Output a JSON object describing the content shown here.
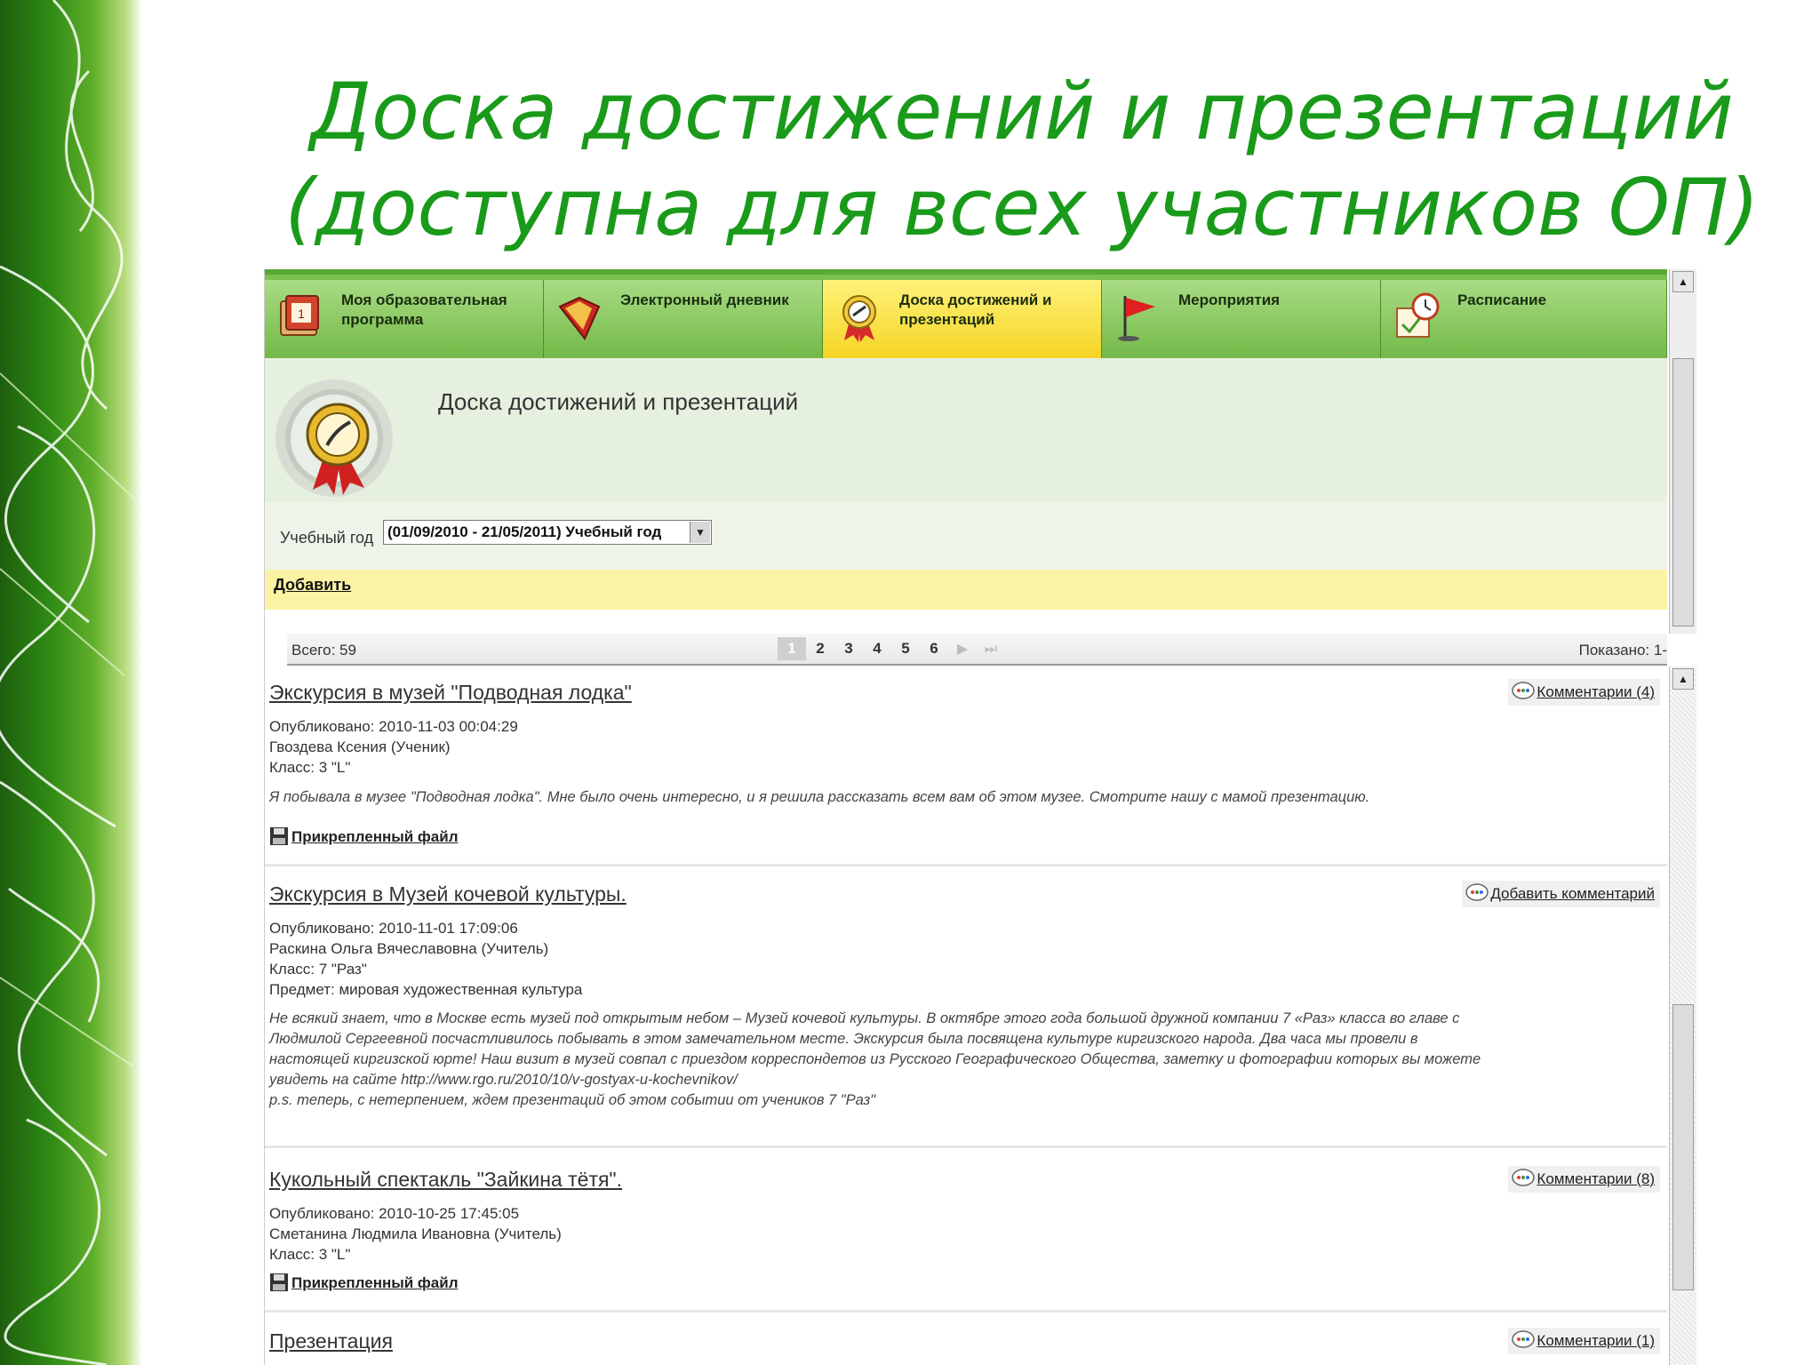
{
  "slide": {
    "title_line1": "Доска достижений и презентаций",
    "title_line2": "(доступна для всех участников ОП)"
  },
  "colors": {
    "title_green": "#1a9a1a",
    "tab_green": "#7cc050",
    "tab_active": "#f4d21e",
    "add_bar": "#fbf2a3"
  },
  "tabs": [
    {
      "label": "Моя образовательная программа",
      "icon": "calendar-book-icon",
      "active": false
    },
    {
      "label": "Электронный дневник",
      "icon": "diary-book-icon",
      "active": false
    },
    {
      "label": "Доска достижений и презентаций",
      "icon": "medal-icon",
      "active": true
    },
    {
      "label": "Мероприятия",
      "icon": "flag-icon",
      "active": false
    },
    {
      "label": "Расписание",
      "icon": "clock-calendar-icon",
      "active": false
    }
  ],
  "page": {
    "heading": "Доска достижений и презентаций"
  },
  "filter": {
    "year_label": "Учебный год",
    "year_value": "(01/09/2010 - 21/05/2011) Учебный год"
  },
  "add_label": "Добавить",
  "pager": {
    "total": "Всего: 59",
    "pages": [
      "1",
      "2",
      "3",
      "4",
      "5",
      "6"
    ],
    "current_page": "1",
    "shown": "Показано: 1-"
  },
  "posts": [
    {
      "title": "Экскурсия в музей \"Подводная лодка\"",
      "published": "Опубликовано: 2010-11-03 00:04:29",
      "author": "Гвоздева Ксения (Ученик)",
      "class": "Класс: 3 \"L\"",
      "description": "Я побывала в музее \"Подводная лодка\". Мне было очень интересно, и я решила рассказать всем вам об этом музее. Смотрите нашу с мамой презентацию.",
      "attachment": "Прикрепленный файл",
      "comments": "Комментарии (4)"
    },
    {
      "title": "Экскурсия в Музей кочевой культуры.",
      "published": "Опубликовано: 2010-11-01 17:09:06",
      "author": "Раскина Ольга Вячеславовна (Учитель)",
      "class": "Класс: 7 \"Раз\"",
      "subject": "Предмет: мировая художественная культура",
      "description_lines": [
        "Не всякий знает, что в Москве есть музей под открытым небом – Музей кочевой культуры. В октябре этого года большой дружной компании 7 «Раз» класса во главе с",
        "Людмилой Сергеевной посчастливилось побывать в этом замечательном месте. Экскурсия была посвящена культуре киргизского народа. Два часа мы провели в",
        "настоящей киргизской юрте! Наш визит в музей совпал с приездом корреспондетов из Русского Географического Общества, заметку и фотографии которых вы можете",
        "увидеть на сайте http://www.rgo.ru/2010/10/v-gostyax-u-kochevnikov/",
        "p.s. теперь, с нетерпением, ждем презентаций об этом событии от учеников 7 \"Раз\""
      ],
      "comments": "Добавить комментарий"
    },
    {
      "title": "Кукольный спектакль \"Зайкина тётя\".",
      "published": "Опубликовано: 2010-10-25 17:45:05",
      "author": "Сметанина Людмила Ивановна (Учитель)",
      "class": "Класс: 3 \"L\"",
      "attachment": "Прикрепленный файл",
      "comments": "Комментарии (8)"
    },
    {
      "title": "Презентация",
      "comments": "Комментарии (1)"
    }
  ]
}
